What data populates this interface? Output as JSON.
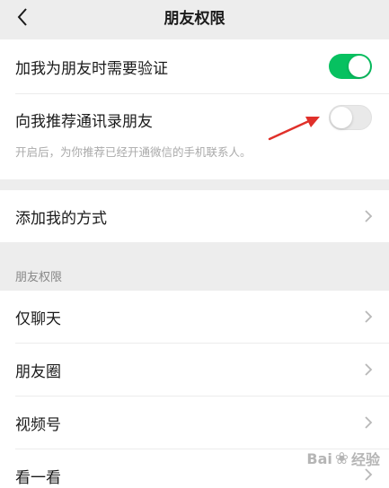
{
  "nav": {
    "title": "朋友权限"
  },
  "settings": {
    "verify": {
      "label": "加我为朋友时需要验证",
      "enabled": true
    },
    "recommend": {
      "label": "向我推荐通讯录朋友",
      "enabled": false,
      "hint": "开启后，为你推荐已经开通微信的手机联系人。"
    },
    "add_methods": {
      "label": "添加我的方式"
    }
  },
  "friend_permissions": {
    "header": "朋友权限",
    "items": [
      {
        "label": "仅聊天"
      },
      {
        "label": "朋友圈"
      },
      {
        "label": "视频号"
      },
      {
        "label": "看一看"
      }
    ]
  },
  "watermark": {
    "text": "Bai",
    "suffix": "经验"
  },
  "colors": {
    "toggle_on": "#07c160",
    "toggle_off": "#e9e9e9",
    "arrow": "#e0302a"
  },
  "icons": [
    "back-chevron-icon",
    "chevron-right-icon",
    "annotation-arrow-icon"
  ]
}
